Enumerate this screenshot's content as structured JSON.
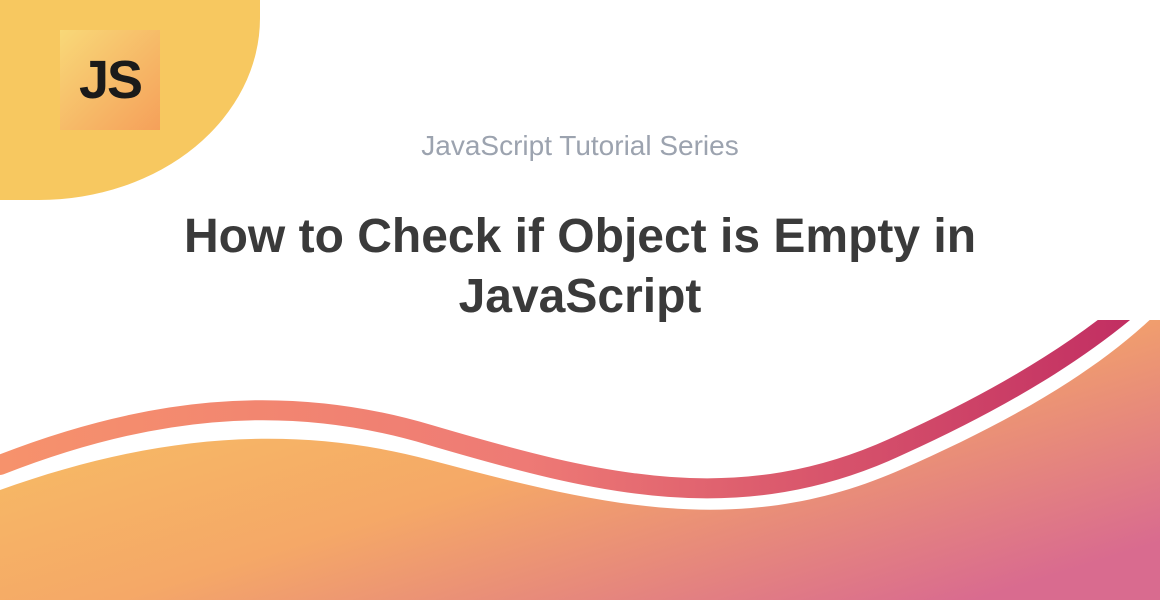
{
  "logo": {
    "text": "JS"
  },
  "subtitle": "JavaScript Tutorial Series",
  "title": "How to Check if Object is Empty in JavaScript",
  "colors": {
    "accent_yellow": "#f7c860",
    "accent_orange": "#f5a05a",
    "accent_pink": "#e8677a",
    "accent_magenta": "#c73668",
    "text_gray": "#9ca3af",
    "text_dark": "#3a3a3a"
  }
}
